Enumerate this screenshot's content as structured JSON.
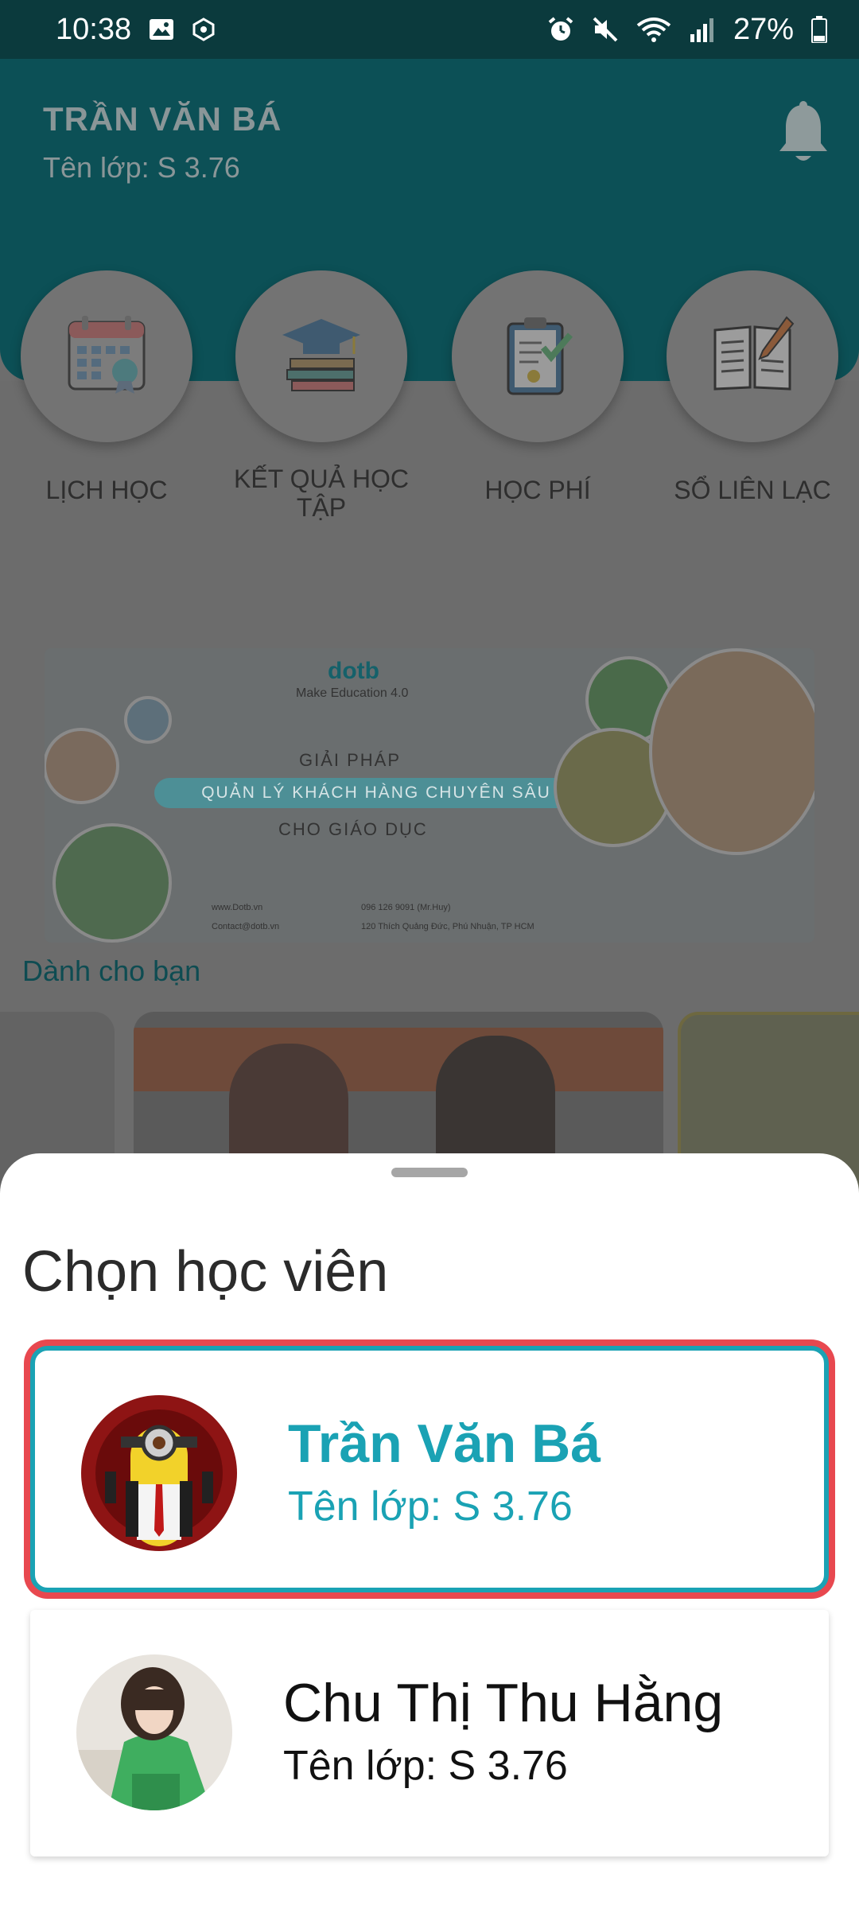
{
  "status_bar": {
    "time": "10:38",
    "battery": "27%",
    "icons_left": [
      "image-icon",
      "hexagon-icon"
    ],
    "icons_right": [
      "alarm-icon",
      "mute-icon",
      "wifi-icon",
      "signal-icon",
      "battery-icon"
    ]
  },
  "header": {
    "student_name": "TRẦN VĂN BÁ",
    "class_label": "Tên lớp: S 3.76",
    "notification_icon": "bell-icon"
  },
  "features": [
    {
      "label": "LỊCH HỌC",
      "icon": "calendar-icon"
    },
    {
      "label": "KẾT QUẢ HỌC TẬP",
      "icon": "graduation-books-icon"
    },
    {
      "label": "HỌC PHÍ",
      "icon": "clipboard-check-icon"
    },
    {
      "label": "SỔ LIÊN LẠC",
      "icon": "open-book-pen-icon"
    }
  ],
  "banner": {
    "logo": "dotb",
    "tagline": "Make Education 4.0",
    "line1": "GIẢI PHÁP",
    "highlight": "QUẢN LÝ KHÁCH HÀNG CHUYÊN SÂU",
    "line2": "CHO GIÁO DỤC",
    "website": "www.Dotb.vn",
    "email": "Contact@dotb.vn",
    "phone": "096 126 9091 (Mr.Huy)",
    "address": "120 Thích Quảng Đức, Phú Nhuận, TP HCM"
  },
  "for_you": {
    "title": "Dành cho bạn"
  },
  "sheet": {
    "title": "Chọn học viên",
    "students": [
      {
        "name": "Trần Văn Bá",
        "class": "Tên lớp: S 3.76",
        "selected": true
      },
      {
        "name": "Chu Thị Thu Hằng",
        "class": "Tên lớp: S 3.76",
        "selected": false
      }
    ]
  },
  "colors": {
    "accent": "#1aa2b4",
    "highlight_border": "#e8484f",
    "header_bg": "#0c5056"
  }
}
